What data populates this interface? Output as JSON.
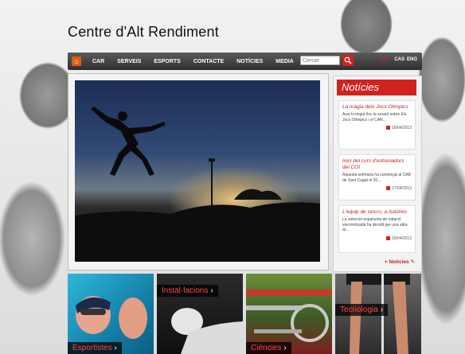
{
  "header": {
    "site_title": "Centre d'Alt Rendiment"
  },
  "nav": {
    "items": [
      "CAR",
      "SERVEIS",
      "ESPORTS",
      "CONTACTE",
      "NOTÍCIES",
      "MEDIA"
    ],
    "search_placeholder": "Cercar",
    "languages": [
      "CAT",
      "CAS",
      "ENG"
    ]
  },
  "news": {
    "title": "Notícies",
    "items": [
      {
        "title": "La màgia dels Jocs Olímpics",
        "body": "Avui hi tingut lloc la sessió sobre Els Jocs Olímpics i el CAR...",
        "date": "18/04/2013"
      },
      {
        "title": "Inici del curs d'entrenadors del COI",
        "body": "Aquesta setmana ha començat al CAR de Sant Cugat el 20...",
        "date": "17/04/2013"
      },
      {
        "title": "L'equip de sincro, a Astúries",
        "body": "La selecció espanyola de natació sincronitzada ha decidit per una altra al...",
        "date": "16/04/2013"
      }
    ],
    "more_label": "+ Notícies"
  },
  "tiles": [
    {
      "label": "Esportistes"
    },
    {
      "label": "Instal·lacions"
    },
    {
      "label": "Ciències"
    },
    {
      "label": "Tecnologia"
    }
  ],
  "colors": {
    "accent": "#d2221e",
    "nav_bg": "#3a3a3a"
  }
}
